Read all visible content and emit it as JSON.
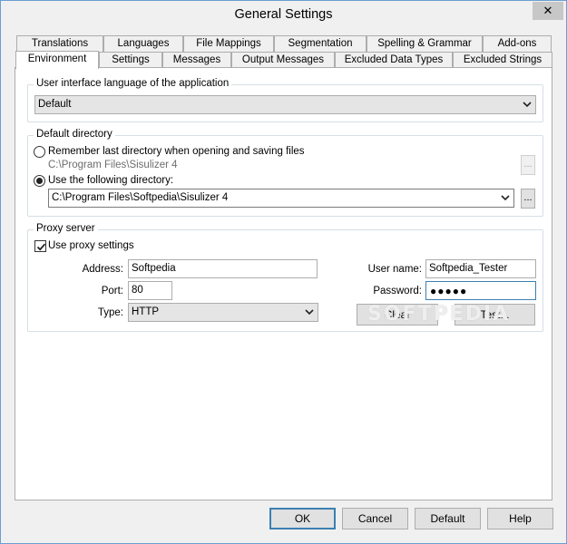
{
  "window": {
    "title": "General Settings",
    "close_glyph": "✕"
  },
  "tabs": {
    "row_back": [
      "Translations",
      "Languages",
      "File Mappings",
      "Segmentation",
      "Spelling & Grammar",
      "Add-ons"
    ],
    "row_front": [
      "Environment",
      "Settings",
      "Messages",
      "Output Messages",
      "Excluded Data Types",
      "Excluded Strings"
    ],
    "active": "Environment"
  },
  "ui_language": {
    "legend": "User interface language of the application",
    "value": "Default"
  },
  "default_directory": {
    "legend": "Default directory",
    "remember_label": "Remember last directory when opening and saving files",
    "remember_path": "C:\\Program Files\\Sisulizer 4",
    "remember_selected": false,
    "following_label": "Use the following directory:",
    "following_selected": true,
    "following_path": "C:\\Program Files\\Softpedia\\Sisulizer 4",
    "browse_label": "..."
  },
  "proxy": {
    "legend": "Proxy server",
    "use_proxy_label": "Use proxy settings",
    "use_proxy_checked": true,
    "address_label": "Address:",
    "address_value": "Softpedia",
    "port_label": "Port:",
    "port_value": "80",
    "type_label": "Type:",
    "type_value": "HTTP",
    "username_label": "User name:",
    "username_value": "Softpedia_Tester",
    "password_label": "Password:",
    "password_masked": "●●●●●",
    "clear_label": "Clear",
    "test_label": "Test..."
  },
  "watermark": "SOFTPEDIA",
  "footer": {
    "ok": "OK",
    "cancel": "Cancel",
    "default": "Default",
    "help": "Help"
  }
}
